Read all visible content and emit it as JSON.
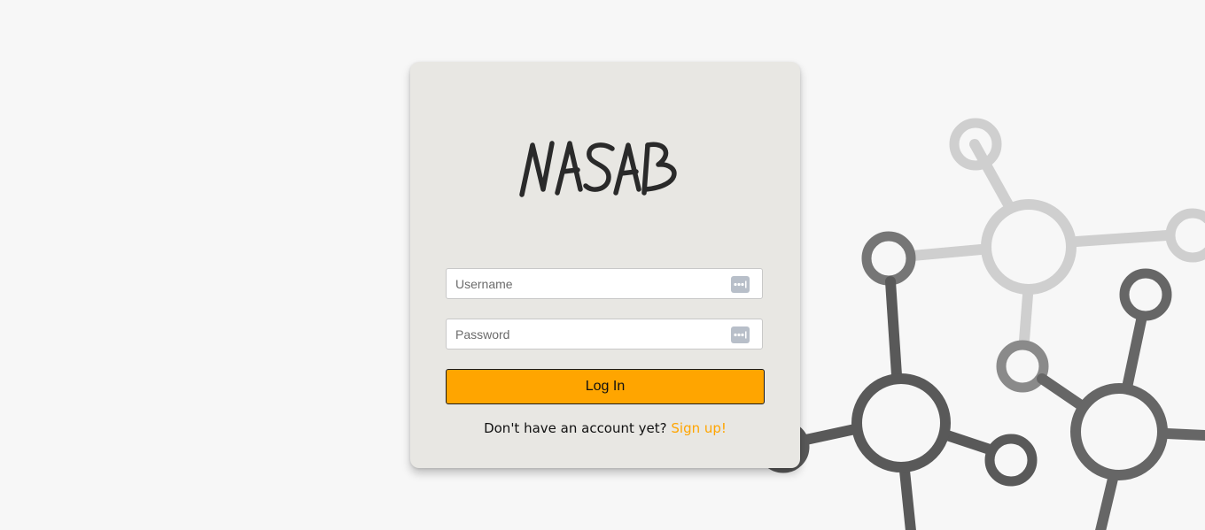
{
  "brand": {
    "logo_text": "NASAB"
  },
  "form": {
    "username_placeholder": "Username",
    "password_placeholder": "Password",
    "login_label": "Log In",
    "signup_prompt": "Don't have an account yet?",
    "signup_link": "Sign up!"
  },
  "colors": {
    "page_background": "#f7f7f7",
    "card_background": "#e8e7e3",
    "accent": "#ffa500",
    "node_dark": "#595959",
    "node_mid": "#666666",
    "node_light": "#cfcfcf"
  },
  "icons": {
    "field_action_icon": "password-manager-icon",
    "background_graphic": "network-nodes-graphic"
  }
}
